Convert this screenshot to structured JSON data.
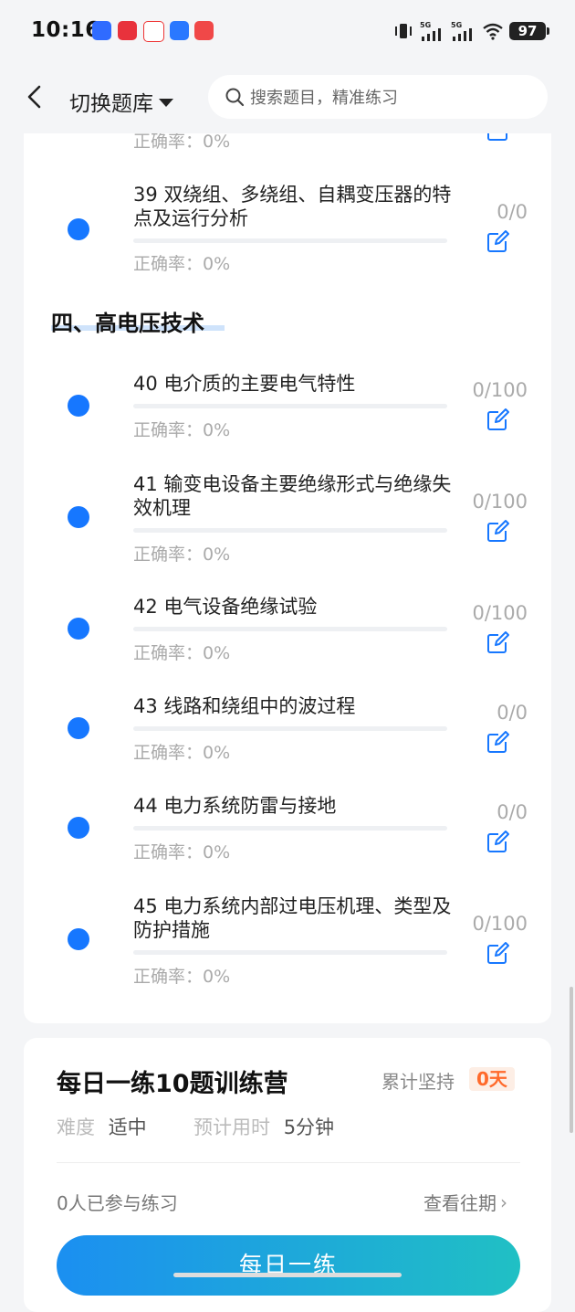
{
  "status_bar": {
    "time": "10:16",
    "battery": "97",
    "network": [
      "5G",
      "5G"
    ]
  },
  "header": {
    "back_label": "返回",
    "switch_label": "切换题库",
    "search_placeholder": "搜索题目，精准练习"
  },
  "chapter_list": {
    "prev_accuracy": "正确率：0%",
    "item_39": {
      "title": "39 双绕组、多绕组、自耦变压器的特点及运行分析",
      "count": "0/0",
      "accuracy": "正确率：0%"
    },
    "section_title": "四、高电压技术",
    "items": [
      {
        "title": "40 电介质的主要电气特性",
        "count": "0/100",
        "accuracy": "正确率：0%"
      },
      {
        "title": "41 输变电设备主要绝缘形式与绝缘失效机理",
        "count": "0/100",
        "accuracy": "正确率：0%"
      },
      {
        "title": "42 电气设备绝缘试验",
        "count": "0/100",
        "accuracy": "正确率：0%"
      },
      {
        "title": "43 线路和绕组中的波过程",
        "count": "0/0",
        "accuracy": "正确率：0%"
      },
      {
        "title": "44 电力系统防雷与接地",
        "count": "0/0",
        "accuracy": "正确率：0%"
      },
      {
        "title": "45 电力系统内部过电压机理、类型及防护措施",
        "count": "0/100",
        "accuracy": "正确率：0%"
      }
    ]
  },
  "camp": {
    "title": "每日一练10题训练营",
    "streak_label": "累计坚持",
    "streak_value": "0天",
    "difficulty_label": "难度",
    "difficulty_value": "适中",
    "time_label": "预计用时",
    "time_value": "5分钟",
    "joined": "0人已参与练习",
    "history_link": "查看往期",
    "button": "每日一练"
  },
  "colors": {
    "accent": "#1677ff",
    "streak": "#ff6a2b"
  }
}
